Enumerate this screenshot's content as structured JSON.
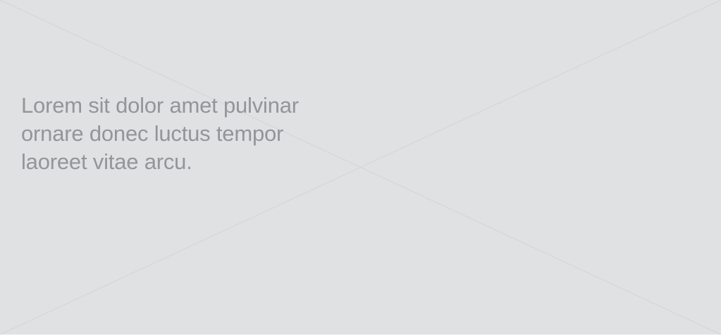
{
  "placeholder": {
    "icon": "image-placeholder-cross-icon",
    "background": "#e0e1e3",
    "line_color": "#d3d4d6",
    "text_color": "#949599"
  },
  "caption": {
    "lines": [
      "Lorem sit dolor amet pulvinar",
      "ornare donec luctus tempor",
      "laoreet vitae arcu."
    ]
  }
}
